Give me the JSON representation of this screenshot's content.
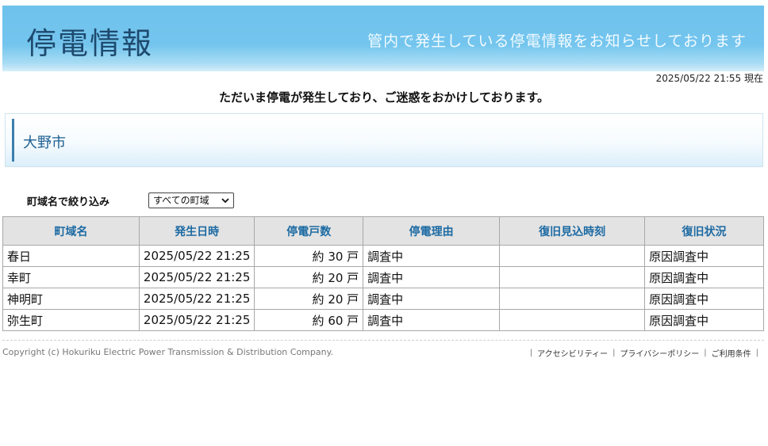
{
  "header": {
    "title": "停電情報",
    "subtitle": "管内で発生している停電情報をお知らせしております"
  },
  "timestamp": "2025/05/22 21:55 現在",
  "notice": "ただいま停電が発生しており、ご迷惑をおかけしております。",
  "city": "大野市",
  "filter": {
    "label": "町域名で絞り込み",
    "selected": "すべての町域"
  },
  "table": {
    "headers": [
      "町域名",
      "発生日時",
      "停電戸数",
      "停電理由",
      "復旧見込時刻",
      "復旧状況"
    ],
    "rows": [
      {
        "town": "春日",
        "datetime": "2025/05/22 21:25",
        "count": "約 30 戸",
        "reason": "調査中",
        "eta": "",
        "status": "原因調査中"
      },
      {
        "town": "幸町",
        "datetime": "2025/05/22 21:25",
        "count": "約 20 戸",
        "reason": "調査中",
        "eta": "",
        "status": "原因調査中"
      },
      {
        "town": "神明町",
        "datetime": "2025/05/22 21:25",
        "count": "約 20 戸",
        "reason": "調査中",
        "eta": "",
        "status": "原因調査中"
      },
      {
        "town": "弥生町",
        "datetime": "2025/05/22 21:25",
        "count": "約 60 戸",
        "reason": "調査中",
        "eta": "",
        "status": "原因調査中"
      }
    ]
  },
  "footer": {
    "copyright": "Copyright (c) Hokuriku Electric Power Transmission & Distribution Company.",
    "links": [
      "アクセシビリティー",
      "プライバシーポリシー",
      "ご利用条件"
    ]
  },
  "colors": {
    "header_bg": "#74c5ee",
    "header_title": "#1e4a6e",
    "table_header_text": "#1c6aa3",
    "city_text": "#1c5f92"
  }
}
